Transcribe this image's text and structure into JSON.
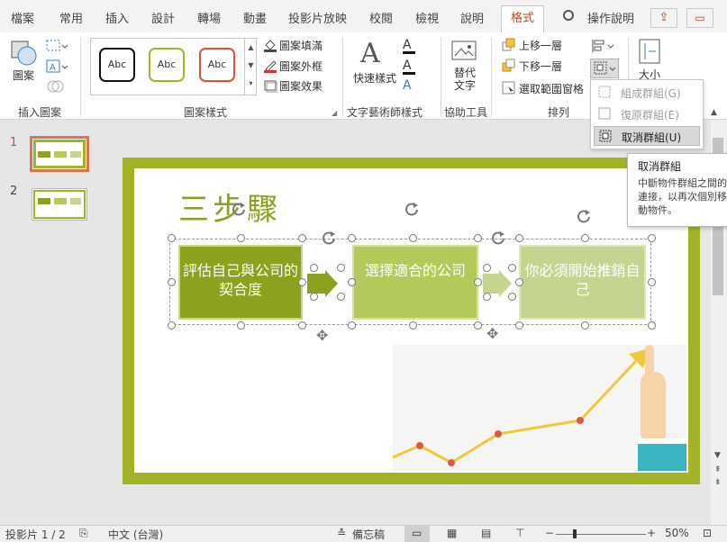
{
  "tabs": [
    "檔案",
    "常用",
    "插入",
    "設計",
    "轉場",
    "動畫",
    "投影片放映",
    "校閱",
    "檢視",
    "說明",
    "格式"
  ],
  "tell_me": "操作說明",
  "ribbon": {
    "insert_shapes": {
      "shapes_label": "圖案",
      "group": "插入圖案"
    },
    "shape_styles": {
      "abc": "Abc",
      "fill": "圖案填滿",
      "outline": "圖案外框",
      "effects": "圖案效果",
      "group": "圖案樣式"
    },
    "wordart": {
      "quick": "快速樣式",
      "group": "文字藝術師樣式"
    },
    "accessibility": {
      "alt_line1": "替代",
      "alt_line2": "文字",
      "group": "協助工具"
    },
    "arrange": {
      "forward": "上移一層",
      "backward": "下移一層",
      "selection": "選取範圍窗格",
      "group": "排列"
    },
    "size": {
      "label": "大小"
    }
  },
  "group_menu": {
    "group": "組成群組(G)",
    "regroup": "復原群組(E)",
    "ungroup": "取消群組(U)"
  },
  "tooltip": {
    "title": "取消群組",
    "body": "中斷物件群組之間的連接，以再次個別移動物件。"
  },
  "slides": [
    {
      "number": "1"
    },
    {
      "number": "2"
    }
  ],
  "slide": {
    "title": "三步驟",
    "step1": "評估自己與公司的契合度",
    "step2": "選擇適合的公司",
    "step3": "你必須開始推銷自己"
  },
  "status": {
    "slide_no": "投影片 1 / 2",
    "language": "中文 (台灣)",
    "notes": "備忘稿",
    "zoom": "50%"
  },
  "colors": {
    "accent": "#b7472a",
    "olive": "#a3b327",
    "step1": "#8aa21e",
    "step2": "#b3c95a",
    "step3": "#c5d48f"
  }
}
